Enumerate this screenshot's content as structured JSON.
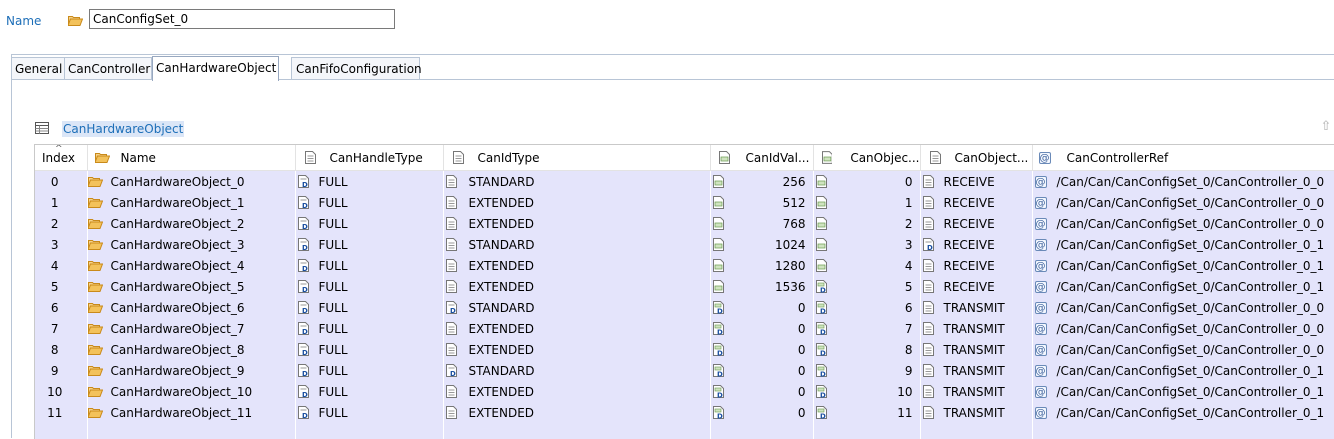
{
  "name_field": {
    "label": "Name",
    "value": "CanConfigSet_0"
  },
  "tabs": [
    {
      "label": "General",
      "active": false
    },
    {
      "label": "CanController",
      "active": false
    },
    {
      "label": "CanHardwareObject",
      "active": true
    },
    {
      "label": "CanFifoConfiguration",
      "active": false
    }
  ],
  "section": {
    "title": "CanHardwareObject"
  },
  "table": {
    "headers": {
      "index": "Index",
      "name": "Name",
      "handle": "CanHandleType",
      "idtype": "CanIdType",
      "idval": "CanIdVal...",
      "objid": "CanObjec...",
      "objtype": "CanObject...",
      "ctrlref": "CanControllerRef"
    },
    "rows": [
      {
        "index": "0",
        "name": "CanHardwareObject_0",
        "handle": "FULL",
        "idtype": "STANDARD",
        "idval": "256",
        "objid": "0",
        "objtype": "RECEIVE",
        "ctrlref": "/Can/Can/CanConfigSet_0/CanController_0_0"
      },
      {
        "index": "1",
        "name": "CanHardwareObject_1",
        "handle": "FULL",
        "idtype": "EXTENDED",
        "idval": "512",
        "objid": "1",
        "objtype": "RECEIVE",
        "ctrlref": "/Can/Can/CanConfigSet_0/CanController_0_0"
      },
      {
        "index": "2",
        "name": "CanHardwareObject_2",
        "handle": "FULL",
        "idtype": "EXTENDED",
        "idval": "768",
        "objid": "2",
        "objtype": "RECEIVE",
        "ctrlref": "/Can/Can/CanConfigSet_0/CanController_0_0"
      },
      {
        "index": "3",
        "name": "CanHardwareObject_3",
        "handle": "FULL",
        "idtype": "STANDARD",
        "idval": "1024",
        "objid": "3",
        "objtype": "RECEIVE",
        "ctrlref": "/Can/Can/CanConfigSet_0/CanController_0_1"
      },
      {
        "index": "4",
        "name": "CanHardwareObject_4",
        "handle": "FULL",
        "idtype": "EXTENDED",
        "idval": "1280",
        "objid": "4",
        "objtype": "RECEIVE",
        "ctrlref": "/Can/Can/CanConfigSet_0/CanController_0_1"
      },
      {
        "index": "5",
        "name": "CanHardwareObject_5",
        "handle": "FULL",
        "idtype": "EXTENDED",
        "idval": "1536",
        "objid": "5",
        "objtype": "RECEIVE",
        "ctrlref": "/Can/Can/CanConfigSet_0/CanController_0_1"
      },
      {
        "index": "6",
        "name": "CanHardwareObject_6",
        "handle": "FULL",
        "idtype": "STANDARD",
        "idval": "0",
        "objid": "6",
        "objtype": "TRANSMIT",
        "ctrlref": "/Can/Can/CanConfigSet_0/CanController_0_0"
      },
      {
        "index": "7",
        "name": "CanHardwareObject_7",
        "handle": "FULL",
        "idtype": "EXTENDED",
        "idval": "0",
        "objid": "7",
        "objtype": "TRANSMIT",
        "ctrlref": "/Can/Can/CanConfigSet_0/CanController_0_0"
      },
      {
        "index": "8",
        "name": "CanHardwareObject_8",
        "handle": "FULL",
        "idtype": "EXTENDED",
        "idval": "0",
        "objid": "8",
        "objtype": "TRANSMIT",
        "ctrlref": "/Can/Can/CanConfigSet_0/CanController_0_0"
      },
      {
        "index": "9",
        "name": "CanHardwareObject_9",
        "handle": "FULL",
        "idtype": "STANDARD",
        "idval": "0",
        "objid": "9",
        "objtype": "TRANSMIT",
        "ctrlref": "/Can/Can/CanConfigSet_0/CanController_0_1"
      },
      {
        "index": "10",
        "name": "CanHardwareObject_10",
        "handle": "FULL",
        "idtype": "EXTENDED",
        "idval": "0",
        "objid": "10",
        "objtype": "TRANSMIT",
        "ctrlref": "/Can/Can/CanConfigSet_0/CanController_0_1"
      },
      {
        "index": "11",
        "name": "CanHardwareObject_11",
        "handle": "FULL",
        "idtype": "EXTENDED",
        "idval": "0",
        "objid": "11",
        "objtype": "TRANSMIT",
        "ctrlref": "/Can/Can/CanConfigSet_0/CanController_0_1"
      }
    ]
  },
  "colors": {
    "accent": "#1e6fb8",
    "row_bg": "#e4e4fb",
    "folder": "#e8a736"
  }
}
